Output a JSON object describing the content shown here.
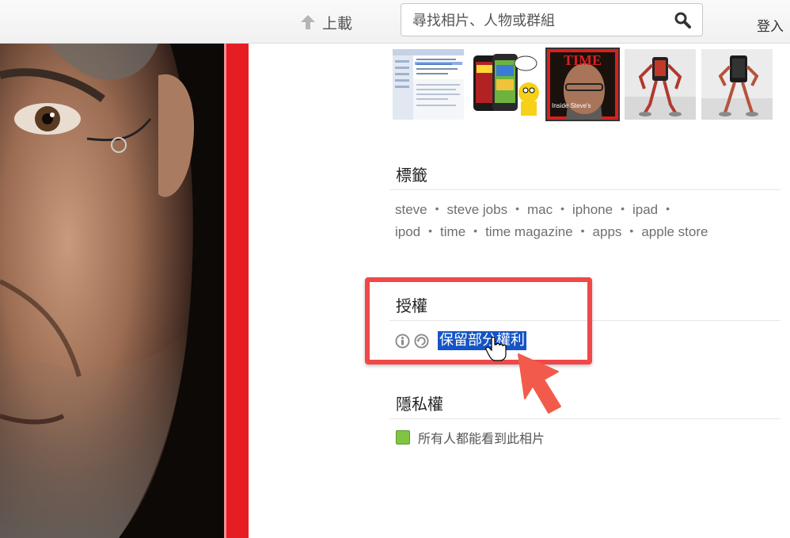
{
  "header": {
    "upload_label": "上載",
    "search_placeholder": "尋找相片、人物或群組",
    "login_label": "登入"
  },
  "tags_section": {
    "title": "標籤",
    "lines": [
      [
        "steve",
        "steve jobs",
        "mac",
        "iphone",
        "ipad"
      ],
      [
        "ipod",
        "time",
        "time magazine",
        "apps",
        "apple store"
      ]
    ]
  },
  "license_section": {
    "title": "授權",
    "license_label": "保留部分權利"
  },
  "privacy_section": {
    "title": "隱私權",
    "status": "所有人都能看到此相片"
  },
  "thumbnails": [
    {
      "name": "thumb-mail-screenshot"
    },
    {
      "name": "thumb-iphone-marvel-comics"
    },
    {
      "name": "thumb-time-cover",
      "cover_title": "TIME",
      "cover_caption": "Inside Steve's"
    },
    {
      "name": "thumb-robot-figure-1"
    },
    {
      "name": "thumb-robot-figure-2"
    }
  ],
  "colors": {
    "accent_red": "#e61e24",
    "selection_blue": "#1554c6",
    "highlight_box": "#f04848",
    "privacy_green": "#7fc542"
  }
}
